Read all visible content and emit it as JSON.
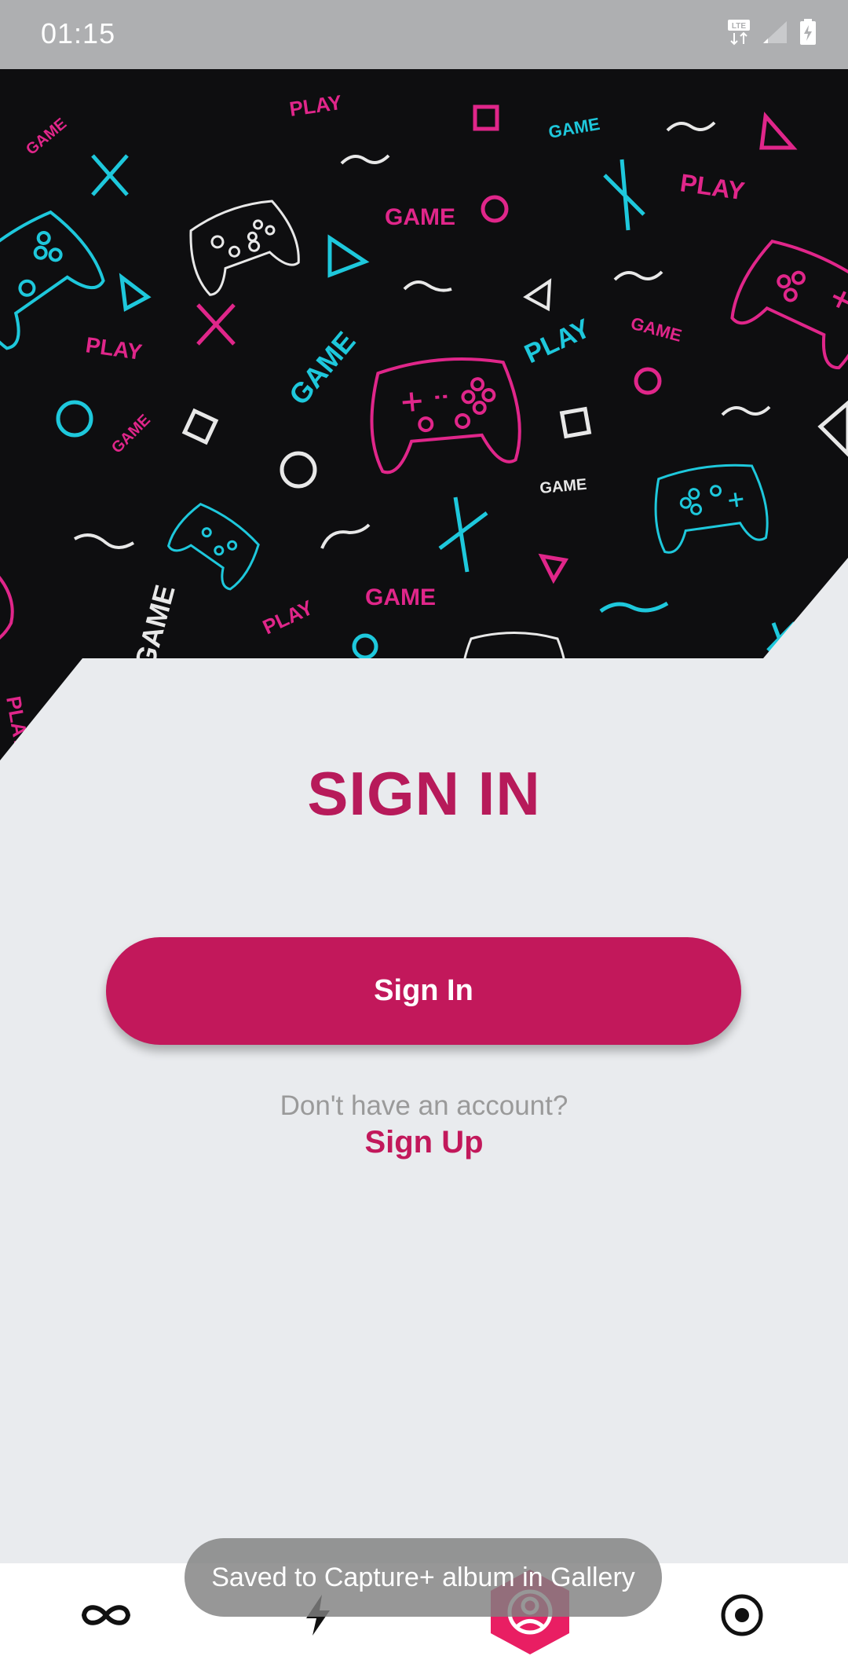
{
  "status_bar": {
    "time": "01:15",
    "icons": [
      "lte-icon",
      "signal-icon",
      "battery-charging-icon"
    ]
  },
  "hero": {
    "pattern_words": [
      "GAME",
      "PLAY",
      "GAME",
      "PLAY",
      "GAME",
      "PLAY",
      "GAME",
      "GAME",
      "PLAY",
      "GAME",
      "GAME",
      "PLAY",
      "GAME",
      "PLAY",
      "GAME"
    ],
    "colors": {
      "background": "#0e0e10",
      "magenta": "#e0268a",
      "cyan": "#1ec8dc",
      "white": "#e8e8e8"
    }
  },
  "main": {
    "title": "SIGN IN",
    "signin_button": "Sign In",
    "no_account_text": "Don't have an account?",
    "signup_link": "Sign Up"
  },
  "bottom_nav": {
    "items": [
      "infinity-icon",
      "bolt-icon",
      "profile-icon",
      "record-icon"
    ],
    "active": "profile-icon",
    "active_color": "#e91e63"
  },
  "toast": {
    "text": "Saved to Capture+ album in Gallery"
  },
  "colors": {
    "accent": "#c2185b",
    "background": "#e9ebee",
    "status_bar": "#aeafb1"
  }
}
